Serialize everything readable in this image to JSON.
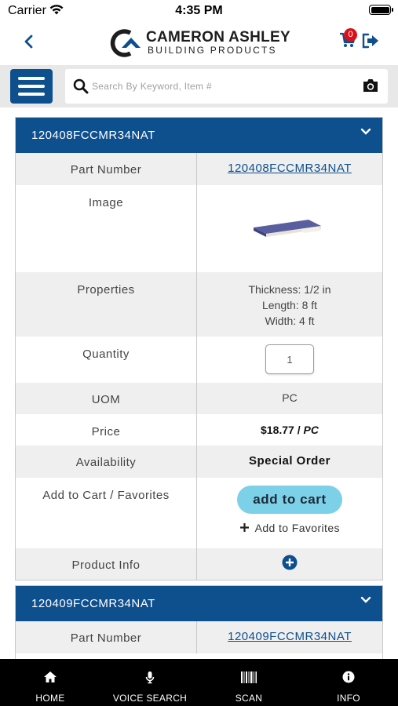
{
  "status_bar": {
    "carrier": "Carrier",
    "time": "4:35 PM"
  },
  "header": {
    "logo_main": "CAMERON ASHLEY",
    "logo_sub": "BUILDING PRODUCTS",
    "cart_count": "0",
    "brand_color": "#0e4f8e",
    "badge_color": "#d9101a"
  },
  "search": {
    "placeholder": "Search By Keyword, Item #"
  },
  "products": [
    {
      "title": "120408FCCMR34NAT",
      "rows": {
        "part_number_label": "Part Number",
        "part_number": "120408FCCMR34NAT",
        "image_label": "Image",
        "properties_label": "Properties",
        "thickness": "Thickness: 1/2 in",
        "length": "Length: 8 ft",
        "width": "Width: 4 ft",
        "quantity_label": "Quantity",
        "quantity": "1",
        "uom_label": "UOM",
        "uom": "PC",
        "price_label": "Price",
        "price": "$18.77",
        "price_unit": "PC",
        "availability_label": "Availability",
        "availability": "Special Order",
        "add_label": "Add to Cart / Favorites",
        "add_to_cart": "add to cart",
        "add_to_favorites": "Add to Favorites",
        "product_info_label": "Product Info"
      }
    },
    {
      "title": "120409FCCMR34NAT",
      "rows": {
        "part_number_label": "Part Number",
        "part_number": "120409FCCMR34NAT"
      }
    }
  ],
  "bottom_nav": {
    "home": "HOME",
    "voice_search": "VOICE SEARCH",
    "scan": "SCAN",
    "info": "INFO"
  },
  "icons": [
    "wifi-icon",
    "battery-icon",
    "back-arrow-icon",
    "cart-icon",
    "logout-icon",
    "hamburger-menu-icon",
    "search-icon",
    "camera-icon",
    "chevron-down-icon",
    "plus-icon",
    "plus-circle-icon",
    "home-icon",
    "microphone-icon",
    "barcode-icon",
    "info-icon"
  ],
  "accent_color": "#7cd0e8"
}
